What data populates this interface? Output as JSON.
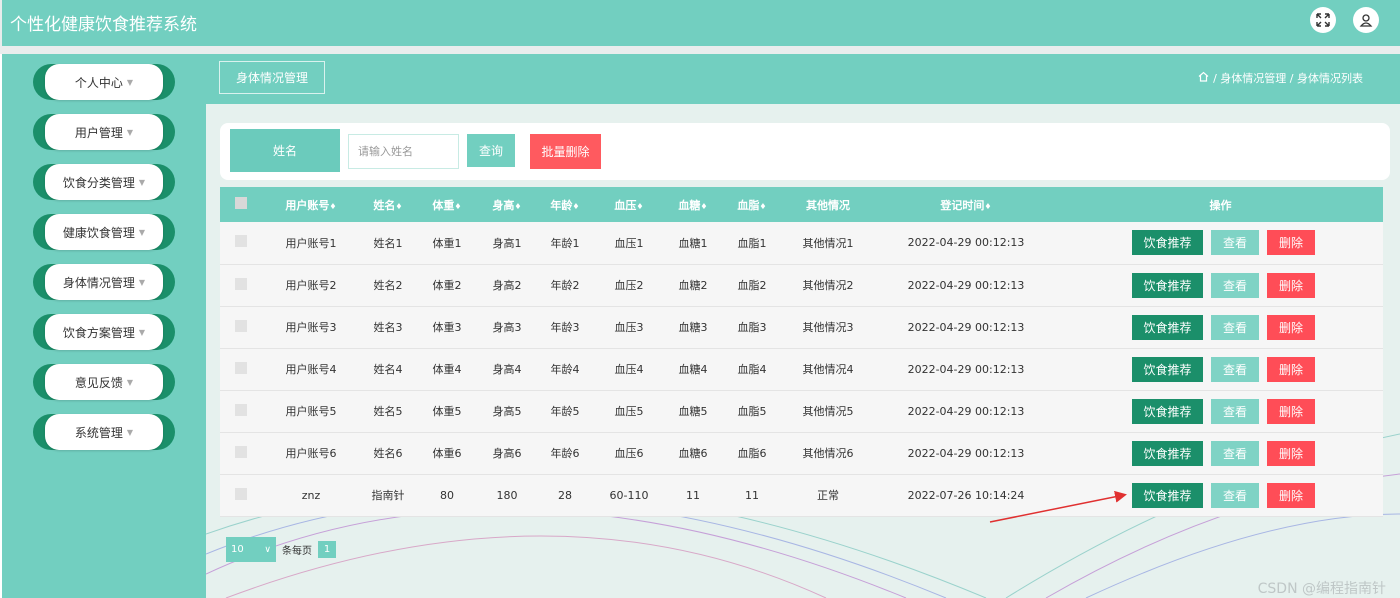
{
  "app": {
    "title": "个性化健康饮食推荐系统"
  },
  "header": {
    "icons": [
      "fullscreen-icon",
      "user-icon"
    ]
  },
  "sidebar": {
    "items": [
      {
        "label": "个人中心"
      },
      {
        "label": "用户管理"
      },
      {
        "label": "饮食分类管理"
      },
      {
        "label": "健康饮食管理"
      },
      {
        "label": "身体情况管理"
      },
      {
        "label": "饮食方案管理"
      },
      {
        "label": "意见反馈"
      },
      {
        "label": "系统管理"
      }
    ]
  },
  "breadcrumb": {
    "tab": "身体情况管理",
    "path": "/ 身体情况管理 / 身体情况列表"
  },
  "search": {
    "label": "姓名",
    "placeholder": "请输入姓名",
    "query_label": "查询",
    "batch_delete_label": "批量删除"
  },
  "table": {
    "columns": [
      "用户账号",
      "姓名",
      "体重",
      "身高",
      "年龄",
      "血压",
      "血糖",
      "血脂",
      "其他情况",
      "登记时间",
      "操作"
    ],
    "rows": [
      [
        "用户账号1",
        "姓名1",
        "体重1",
        "身高1",
        "年龄1",
        "血压1",
        "血糖1",
        "血脂1",
        "其他情况1",
        "2022-04-29 00:12:13"
      ],
      [
        "用户账号2",
        "姓名2",
        "体重2",
        "身高2",
        "年龄2",
        "血压2",
        "血糖2",
        "血脂2",
        "其他情况2",
        "2022-04-29 00:12:13"
      ],
      [
        "用户账号3",
        "姓名3",
        "体重3",
        "身高3",
        "年龄3",
        "血压3",
        "血糖3",
        "血脂3",
        "其他情况3",
        "2022-04-29 00:12:13"
      ],
      [
        "用户账号4",
        "姓名4",
        "体重4",
        "身高4",
        "年龄4",
        "血压4",
        "血糖4",
        "血脂4",
        "其他情况4",
        "2022-04-29 00:12:13"
      ],
      [
        "用户账号5",
        "姓名5",
        "体重5",
        "身高5",
        "年龄5",
        "血压5",
        "血糖5",
        "血脂5",
        "其他情况5",
        "2022-04-29 00:12:13"
      ],
      [
        "用户账号6",
        "姓名6",
        "体重6",
        "身高6",
        "年龄6",
        "血压6",
        "血糖6",
        "血脂6",
        "其他情况6",
        "2022-04-29 00:12:13"
      ],
      [
        "znz",
        "指南针",
        "80",
        "180",
        "28",
        "60-110",
        "11",
        "11",
        "正常",
        "2022-07-26 10:14:24"
      ]
    ],
    "actions": {
      "recommend": "饮食推荐",
      "view": "查看",
      "delete": "删除"
    }
  },
  "pagination": {
    "page_size": "10",
    "per_page_label": "条每页",
    "current_page": "1"
  },
  "watermark": "CSDN @编程指南针",
  "colors": {
    "primary": "#72cfc0",
    "dark_green": "#1b8f6a",
    "danger": "#ff4d57"
  }
}
